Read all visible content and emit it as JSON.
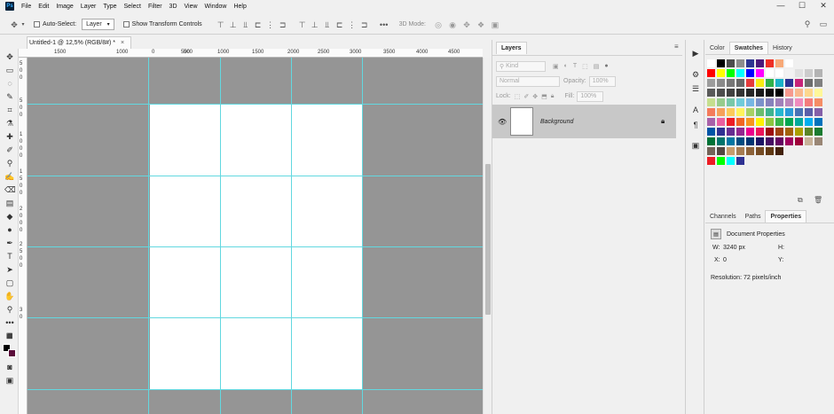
{
  "app": {
    "logo": "Ps"
  },
  "menu": [
    "File",
    "Edit",
    "Image",
    "Layer",
    "Type",
    "Select",
    "Filter",
    "3D",
    "View",
    "Window",
    "Help"
  ],
  "window_controls": [
    "—",
    "☐",
    "✕"
  ],
  "options": {
    "auto_select_label": "Auto-Select:",
    "auto_select_value": "Layer",
    "transform_label": "Show Transform Controls",
    "mode_3d_label": "3D Mode:"
  },
  "document": {
    "tab_title": "Untitled-1 @ 12,5% (RGB/8#) *",
    "close": "×"
  },
  "ruler_top_labels": [
    "1500",
    "1000",
    "500",
    "0",
    "500",
    "1000",
    "1500",
    "2000",
    "2500",
    "3000",
    "3500",
    "4000",
    "4500"
  ],
  "ruler_left_labels": [
    "5",
    "0",
    "0",
    "5",
    "0",
    "0",
    "1",
    "0",
    "0",
    "0",
    "1",
    "5",
    "0",
    "0",
    "2",
    "0",
    "0",
    "0",
    "2",
    "5",
    "0",
    "0",
    "3",
    "0"
  ],
  "layers": {
    "tab": "Layers",
    "kind": "Kind",
    "blend": "Normal",
    "opacity_label": "Opacity:",
    "opacity_value": "100%",
    "lock_label": "Lock:",
    "fill_label": "Fill:",
    "fill_value": "100%",
    "layer_name": "Background"
  },
  "right_tabs": [
    "Color",
    "Swatches",
    "History"
  ],
  "right_tabs_active": "Swatches",
  "swatches": {
    "rows": [
      [
        "#ffffff",
        "#000000",
        "#4d4d4d",
        "#8c8c8c",
        "#2d3590",
        "#4b1a7b",
        "#ee2e24",
        "#f7a978",
        "#ffffff"
      ],
      [
        "#ff0000",
        "#ffff00",
        "#00ff00",
        "#00ffff",
        "#0000ff",
        "#ff00ff",
        "#ffffff",
        "#ffffff",
        "#f2f2f2",
        "#e0e0e0",
        "#cccccc",
        "#b3b3b3"
      ],
      [
        "#9c9c9c",
        "#8a8a8a",
        "#767676",
        "#666666",
        "#e53a3a",
        "#f7ec13",
        "#2fb14a",
        "#1bb2c7",
        "#2e3394",
        "#c72479",
        "#6d6d6d",
        "#808080"
      ],
      [
        "#595959",
        "#4d4d4d",
        "#404040",
        "#333333",
        "#262626",
        "#1a1a1a",
        "#0d0d0d",
        "#000000",
        "#f6998e",
        "#f9b98e",
        "#fdd78d",
        "#fff799"
      ],
      [
        "#c5df8e",
        "#97cc8c",
        "#78c8a8",
        "#6fcbd9",
        "#76b6e3",
        "#7b92ca",
        "#8681bc",
        "#a080ba",
        "#bc86bb",
        "#f08cbe",
        "#f47c7c",
        "#f58d65"
      ],
      [
        "#f47b5b",
        "#f6a05a",
        "#fbca5a",
        "#fff35c",
        "#a7d164",
        "#6bbd6e",
        "#3eb38f",
        "#27b6cf",
        "#2a9ad9",
        "#4872b6",
        "#5a5fa9",
        "#8460a8"
      ],
      [
        "#a861a9",
        "#ea5fa0",
        "#ed1c24",
        "#f26522",
        "#f7941d",
        "#fff200",
        "#8dc63f",
        "#39b54a",
        "#00a651",
        "#00a99d",
        "#00aeef",
        "#0072bc"
      ],
      [
        "#0054a6",
        "#2e3192",
        "#662d91",
        "#92278f",
        "#ec008c",
        "#ed145b",
        "#9e0b0f",
        "#a0410d",
        "#a36209",
        "#aba000",
        "#598527",
        "#197b30"
      ],
      [
        "#007236",
        "#00746b",
        "#0076a3",
        "#004b80",
        "#003471",
        "#1b1464",
        "#440e62",
        "#630460",
        "#9e005d",
        "#9e0039",
        "#c7b299",
        "#998675"
      ],
      [
        "#736357",
        "#534741",
        "#c69c6d",
        "#a67c52",
        "#8c6239",
        "#754c24",
        "#603913",
        "#42210b"
      ],
      [
        "#ed1c24",
        "#00ff00",
        "#00ffff",
        "#2e3192"
      ]
    ]
  },
  "lower_tabs": [
    "Channels",
    "Paths",
    "Properties"
  ],
  "lower_tabs_active": "Properties",
  "properties": {
    "title": "Document Properties",
    "w_label": "W:",
    "w_value": "3240 px",
    "h_label": "H:",
    "x_label": "X:",
    "x_value": "0",
    "y_label": "Y:",
    "resolution": "Resolution: 72 pixels/inch"
  }
}
